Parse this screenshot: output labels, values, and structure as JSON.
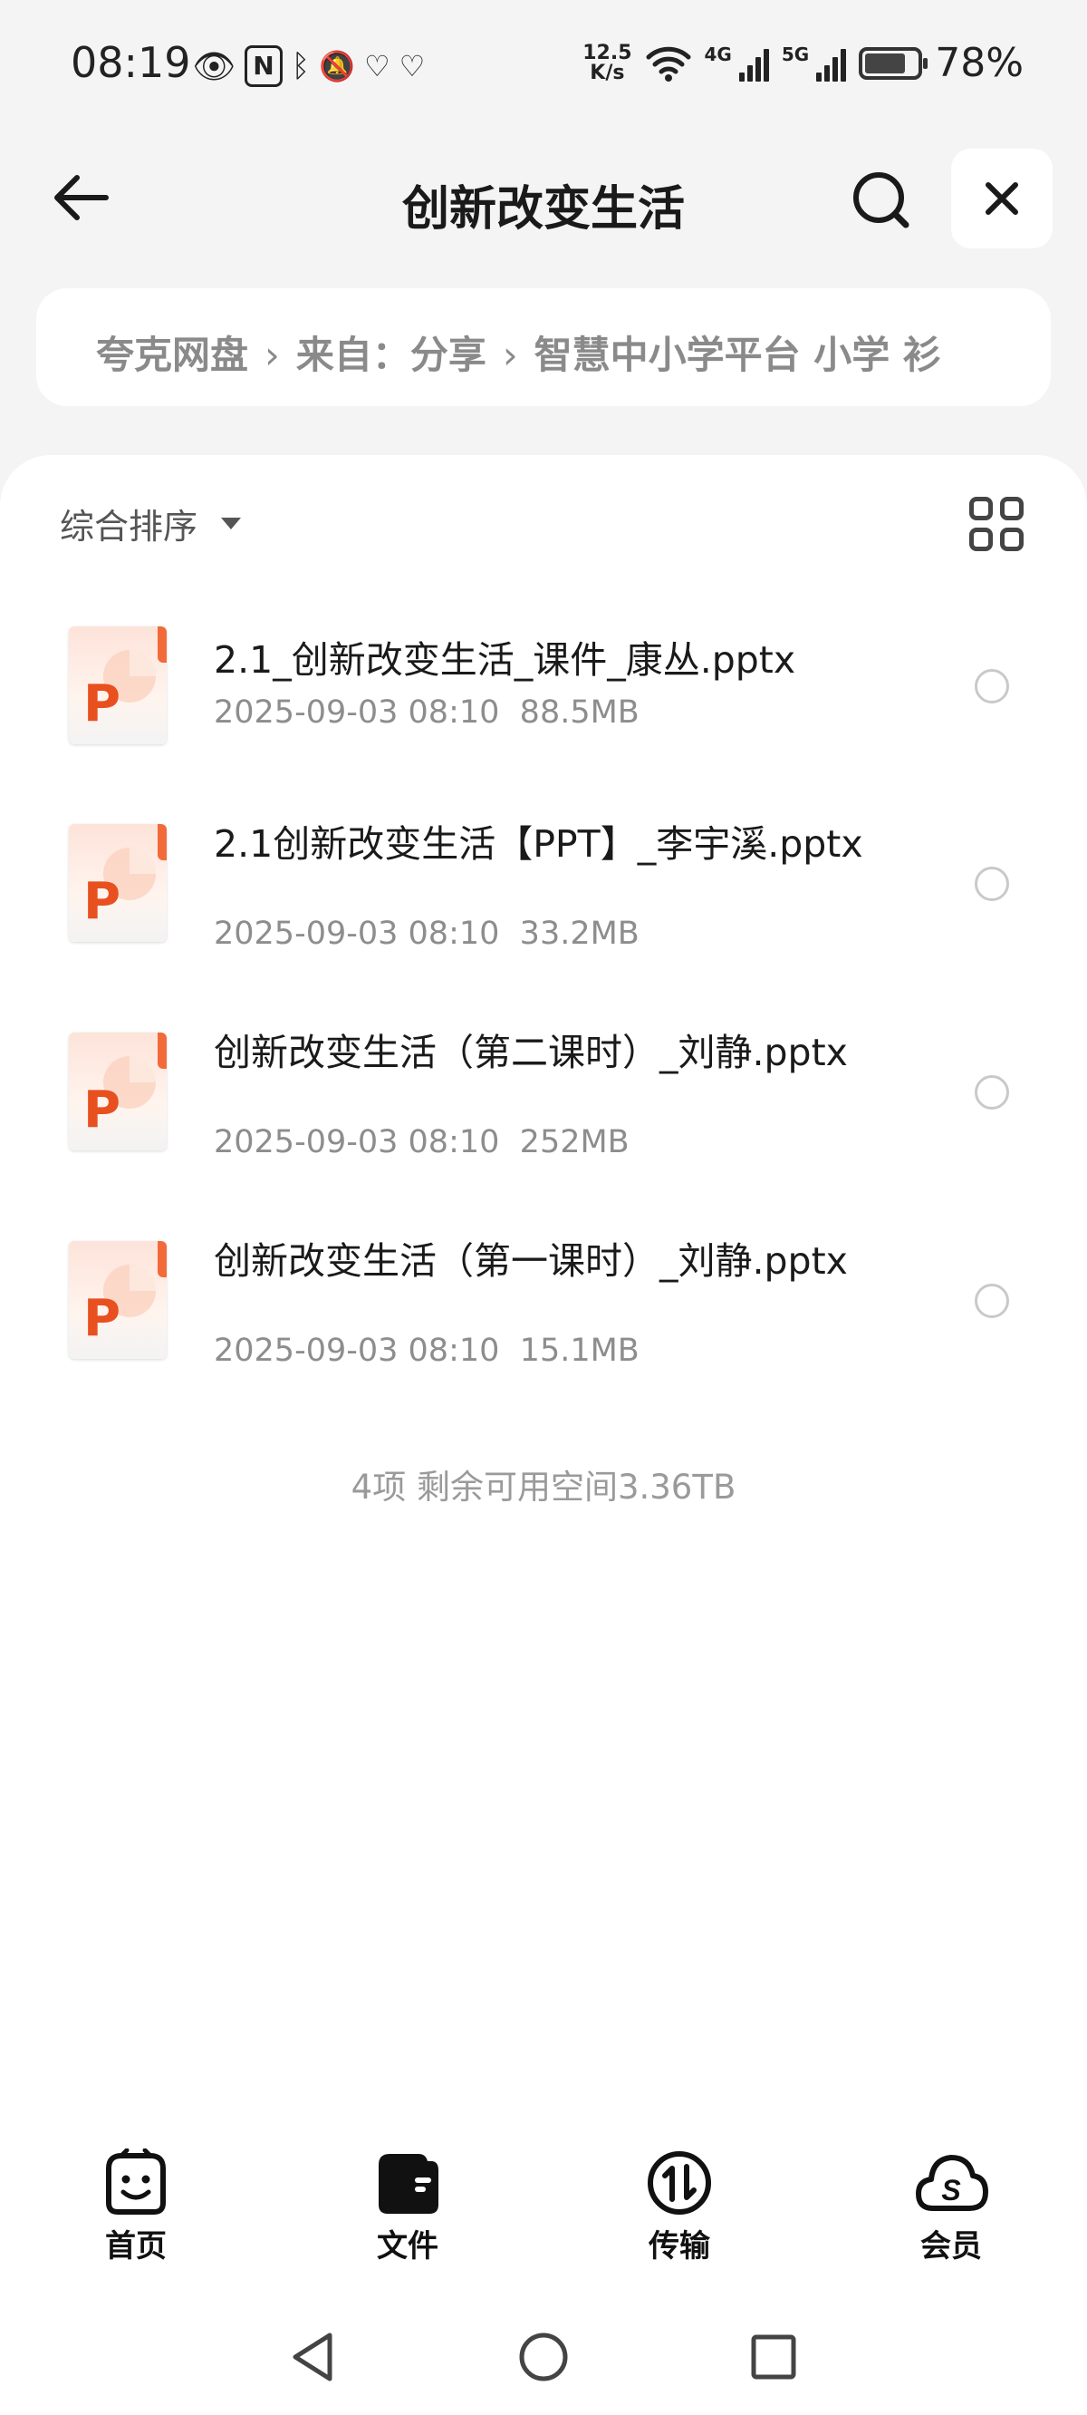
{
  "status_bar": {
    "time": "08:19",
    "net_speed_value": "12.5",
    "net_speed_unit": "K/s",
    "signal_1_label": "4G",
    "signal_2_label": "5G",
    "battery_percent": "78%",
    "battery_level": 0.78
  },
  "header": {
    "title": "创新改变生活"
  },
  "breadcrumb": {
    "items": [
      "夸克网盘",
      "来自：分享",
      "智慧中小学平台 小学 衫"
    ]
  },
  "toolbar": {
    "sort_label": "综合排序"
  },
  "files": [
    {
      "name": "2.1_创新改变生活_课件_康丛.pptx",
      "date": "2025-09-03 08:10",
      "size": "88.5MB"
    },
    {
      "name": "2.1创新改变生活【PPT】_李宇溪.pptx",
      "date": "2025-09-03 08:10",
      "size": "33.2MB"
    },
    {
      "name": "创新改变生活（第二课时）_刘静.pptx",
      "date": "2025-09-03 08:10",
      "size": "252MB"
    },
    {
      "name": "创新改变生活（第一课时）_刘静.pptx",
      "date": "2025-09-03 08:10",
      "size": "15.1MB"
    }
  ],
  "file_icon_letter": "P",
  "summary": "4项 剩余可用空间3.36TB",
  "bottom_nav": [
    {
      "label": "首页",
      "icon": "smiley-face-icon"
    },
    {
      "label": "文件",
      "icon": "wallet-folder-icon"
    },
    {
      "label": "传输",
      "icon": "transfer-arrows-icon"
    },
    {
      "label": "会员",
      "icon": "cloud-s-icon"
    }
  ],
  "colors": {
    "accent_orange": "#e8501f",
    "background": "#f4f4f5",
    "muted_text": "#8d8d8d"
  }
}
